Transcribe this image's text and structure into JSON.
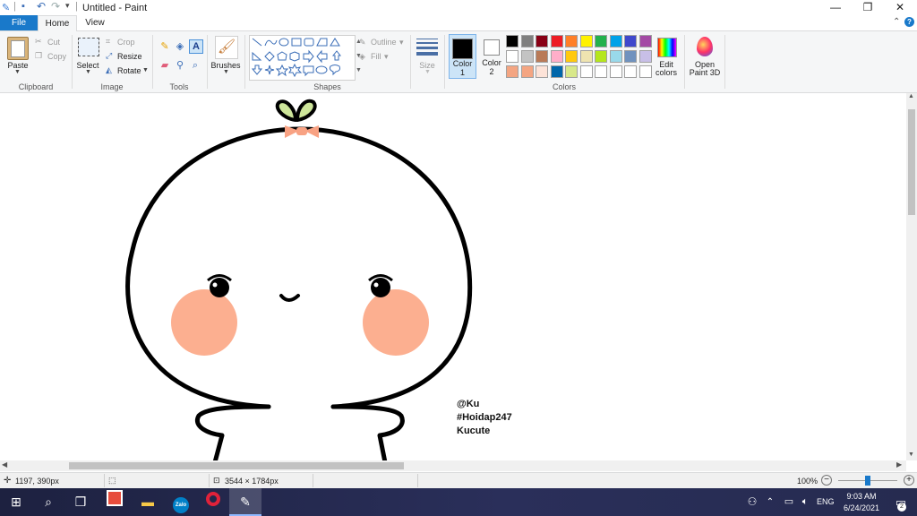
{
  "window": {
    "title": "Untitled - Paint"
  },
  "tabs": {
    "file": "File",
    "home": "Home",
    "view": "View"
  },
  "clipboard": {
    "paste": "Paste",
    "cut": "Cut",
    "copy": "Copy",
    "group": "Clipboard"
  },
  "image": {
    "select": "Select",
    "crop": "Crop",
    "resize": "Resize",
    "rotate": "Rotate",
    "group": "Image"
  },
  "tools": {
    "group": "Tools"
  },
  "brushes": {
    "label": "Brushes"
  },
  "shapes": {
    "outline": "Outline",
    "fill": "Fill",
    "group": "Shapes"
  },
  "size": {
    "label": "Size"
  },
  "color1": {
    "label": "Color",
    "num": "1",
    "value": "#000000"
  },
  "color2": {
    "label": "Color",
    "num": "2",
    "value": "#ffffff"
  },
  "colors": {
    "group": "Colors",
    "edit_line1": "Edit",
    "edit_line2": "colors",
    "palette": [
      "#000000",
      "#7f7f7f",
      "#880015",
      "#ed1c24",
      "#ff7f27",
      "#fff200",
      "#22b14c",
      "#00a2e8",
      "#3f48cc",
      "#a349a4",
      "#ffffff",
      "#c3c3c3",
      "#b97a57",
      "#ffaec9",
      "#ffc90e",
      "#efe4b0",
      "#b5e61d",
      "#99d9ea",
      "#7092be",
      "#c8bfe7",
      "#f4a582",
      "#f4a582",
      "#fde3d8",
      "#0066aa",
      "#d8e88a",
      "#ffffff",
      "#ffffff",
      "#ffffff",
      "#ffffff",
      "#ffffff"
    ]
  },
  "paint3d": {
    "line1": "Open",
    "line2": "Paint 3D"
  },
  "canvas": {
    "signature": [
      "@Ku",
      "#Hoidap247",
      "Kucute"
    ],
    "cheek_color": "#fcaf90",
    "bow_color": "#f8a283",
    "sprout_color": "#cde59a"
  },
  "status": {
    "cursor": "1197, 390px",
    "image_size": "3544 × 1784px",
    "zoom": "100%",
    "zoom_level": 0.5
  },
  "taskbar": {
    "lang": "ENG",
    "time": "9:03 AM",
    "date": "6/24/2021",
    "notifications": "2",
    "zalo": "Zalo"
  }
}
